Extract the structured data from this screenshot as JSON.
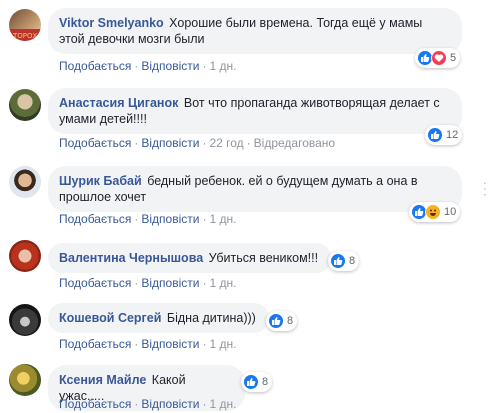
{
  "actions": {
    "like": "Подобається",
    "reply": "Відповісти",
    "edited": "Відредаговано"
  },
  "comments": [
    {
      "author": "Viktor Smelyanko",
      "text": "Хорошие были времена. Тогда ещё у мамы этой девочки мозги были",
      "time": "1 дн.",
      "reaction_count": "5",
      "reactions": [
        "like-icon",
        "love-icon"
      ]
    },
    {
      "author": "Анастасия Циганок",
      "text": "Вот что пропаганда животворящая делает с умами детей!!!!",
      "time": "22 год",
      "reaction_count": "12",
      "reactions": [
        "like-icon"
      ]
    },
    {
      "author": "Шурик Бабай",
      "text": "бедный ребенок. ей о будущем думать а она в прошлое хочет",
      "time": "1 дн.",
      "reaction_count": "10",
      "reactions": [
        "like-icon",
        "haha-icon"
      ]
    },
    {
      "author": "Валентина Чернышова",
      "text": "Убиться веником!!!",
      "time": "1 дн.",
      "reaction_count": "8",
      "reactions": [
        "like-icon"
      ]
    },
    {
      "author": "Кошевой Сергей",
      "text": "Бідна дитина)))",
      "time": "1 дн.",
      "reaction_count": "8",
      "reactions": [
        "like-icon"
      ]
    },
    {
      "author": "Ксения Майле",
      "text": "Какой ужас.....",
      "time": "1 дн.",
      "reaction_count": "8",
      "reactions": [
        "like-icon"
      ]
    }
  ],
  "colors": {
    "link": "#385898",
    "bubble": "#f2f3f5",
    "like": "#1877f2",
    "love": "#f33e58",
    "haha": "#f7b125"
  }
}
